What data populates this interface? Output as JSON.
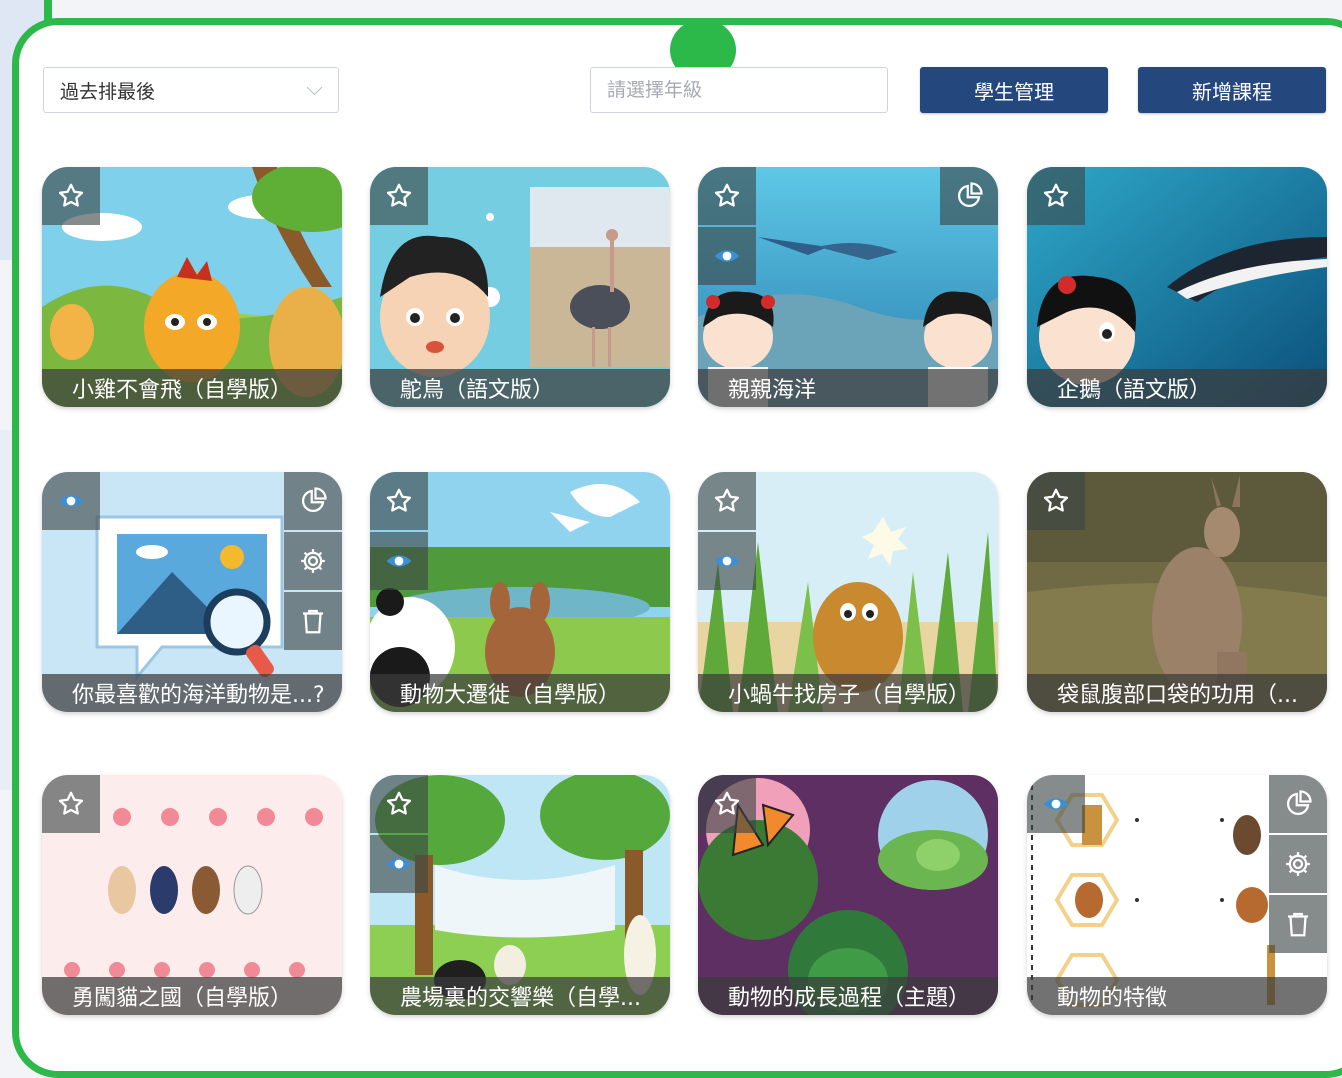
{
  "toolbar": {
    "sort_value": "過去排最後",
    "grade_placeholder": "請選擇年級",
    "student_manage_label": "學生管理",
    "add_course_label": "新增課程"
  },
  "courses": [
    {
      "title": "小雞不會飛（自學版）",
      "icons": [
        "star-icon"
      ]
    },
    {
      "title": "鴕鳥（語文版）",
      "icons": [
        "star-icon"
      ]
    },
    {
      "title": "親親海洋",
      "icons": [
        "star-icon",
        "eye-icon",
        "pie-chart-icon"
      ]
    },
    {
      "title": "企鵝（語文版）",
      "icons": [
        "star-icon"
      ]
    },
    {
      "title": "你最喜歡的海洋動物是...?",
      "icons": [
        "eye-icon",
        "pie-chart-icon",
        "gear-icon",
        "trash-icon"
      ]
    },
    {
      "title": "動物大遷徙（自學版）",
      "icons": [
        "star-icon",
        "eye-icon"
      ]
    },
    {
      "title": "小蝸牛找房子（自學版）",
      "icons": [
        "star-icon",
        "eye-icon"
      ]
    },
    {
      "title": "袋鼠腹部口袋的功用（...",
      "icons": [
        "star-icon"
      ]
    },
    {
      "title": "勇闖貓之國（自學版）",
      "icons": [
        "star-icon"
      ]
    },
    {
      "title": "農場裏的交響樂（自學...",
      "icons": [
        "star-icon",
        "eye-icon"
      ]
    },
    {
      "title": "動物的成長過程（主題）",
      "icons": [
        "star-icon"
      ]
    },
    {
      "title": "動物的特徵",
      "icons": [
        "eye-icon",
        "pie-chart-icon",
        "gear-icon",
        "trash-icon"
      ]
    }
  ],
  "colors": {
    "frame_green": "#2db84a",
    "button_navy": "#24477e"
  }
}
